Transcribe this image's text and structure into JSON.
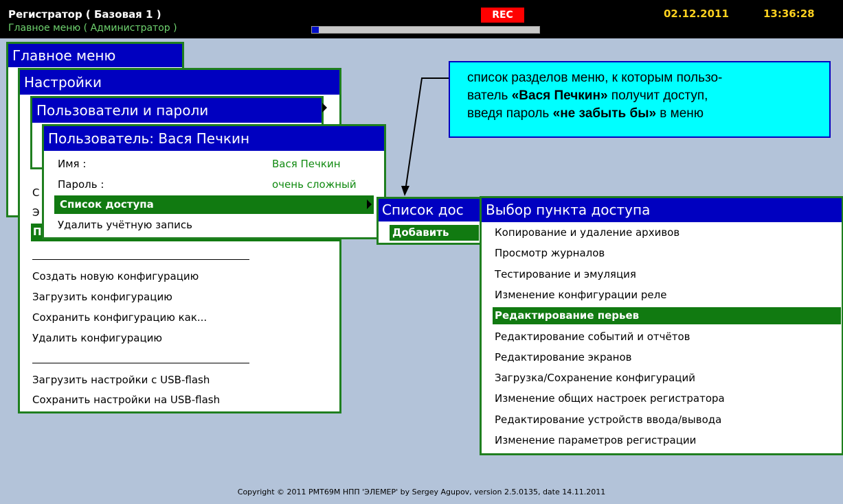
{
  "header": {
    "title": "Регистратор ( Базовая 1 )",
    "subtitle": "Главное меню ( Администратор )",
    "rec": "REC",
    "date": "02.12.2011",
    "time": "13:36:28",
    "progress": 0.03
  },
  "main_menu": {
    "title": "Главное меню"
  },
  "settings_menu": {
    "title": "Настройки",
    "partial_items": [
      "С",
      "Э",
      "П"
    ],
    "items": [
      "Создать новую конфигурацию",
      "Загрузить конфигурацию",
      "Сохранить конфигурацию как...",
      "Удалить конфигурацию",
      "Загрузить настройки с USB-flash",
      "Сохранить настройки на USB-flash"
    ]
  },
  "users_menu": {
    "title": "Пользователи и пароли"
  },
  "user_menu": {
    "title": "Пользователь: Вася Печкин",
    "name_label": "Имя :",
    "name_value": "Вася Печкин",
    "password_label": "Пароль :",
    "password_value": "очень сложный",
    "access_list": "Список доступа",
    "delete": "Удалить учётную запись"
  },
  "access_list_menu": {
    "title": "Список дос",
    "add": "Добавить"
  },
  "access_select_menu": {
    "title": "Выбор пункта доступа",
    "items": [
      "Копирование и удаление архивов",
      "Просмотр журналов",
      "Тестирование и эмуляция",
      "Изменение конфигурации реле",
      "Редактирование перьев",
      "Редактирование событий и отчётов",
      "Редактирование экранов",
      "Загрузка/Сохранение конфигураций",
      "Изменение общих настроек регистратора",
      "Редактирование устройств ввода/вывода",
      "Изменение параметров регистрации"
    ],
    "selected_index": 4
  },
  "callout": {
    "line1": "список разделов меню, к которым пользо-",
    "line2_pre": "ватель ",
    "line2_bold": "«Вася Печкин»",
    "line2_post": " получит доступ,",
    "line3_pre": "введя пароль ",
    "line3_bold": "«не забыть бы»",
    "line3_post": " в меню"
  },
  "footer": {
    "copyright": "Copyright © 2011 РМТ69М НПП 'ЭЛЕМЕР' by Sergey Agupov, version 2.5.0135, date 14.11.2011"
  },
  "colors": {
    "background": "#b3c3d9",
    "header_blue": "#0000c0",
    "selection_green": "#117a11",
    "border_green": "#1f7f1f",
    "callout": "#00ffff",
    "rec": "#ff0000",
    "datetime": "#ffd21f"
  }
}
